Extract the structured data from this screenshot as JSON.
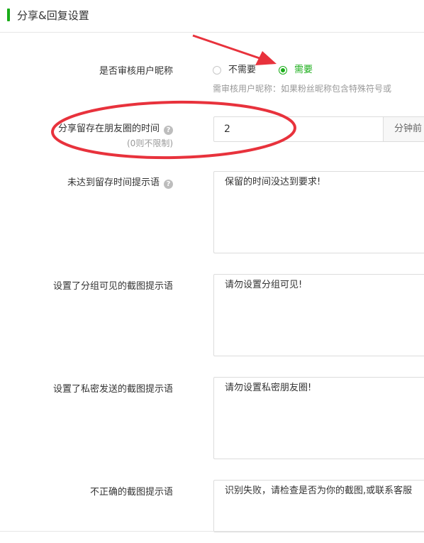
{
  "section": {
    "title": "分享&回复设置"
  },
  "nickname_review": {
    "label": "是否审核用户昵称",
    "options": [
      {
        "label": "不需要",
        "checked": false
      },
      {
        "label": "需要",
        "checked": true
      }
    ],
    "hint": "需审核用户昵称：如果粉丝昵称包含特殊符号或"
  },
  "share_retention": {
    "label": "分享留存在朋友圈的时间",
    "sublabel": "(0则不限制)",
    "value": "2",
    "unit": "分钟前"
  },
  "textareas": [
    {
      "label": "未达到留存时间提示语",
      "has_help": true,
      "value": "保留的时间没达到要求!"
    },
    {
      "label": "设置了分组可见的截图提示语",
      "has_help": false,
      "value": "请勿设置分组可见!"
    },
    {
      "label": "设置了私密发送的截图提示语",
      "has_help": false,
      "value": "请勿设置私密朋友圈!"
    },
    {
      "label": "不正确的截图提示语",
      "has_help": false,
      "value": "识别失败，请检查是否为你的截图,或联系客服"
    }
  ],
  "help_icon_glyph": "?",
  "colors": {
    "accent": "#1aad19",
    "annotation": "#e8323c"
  }
}
